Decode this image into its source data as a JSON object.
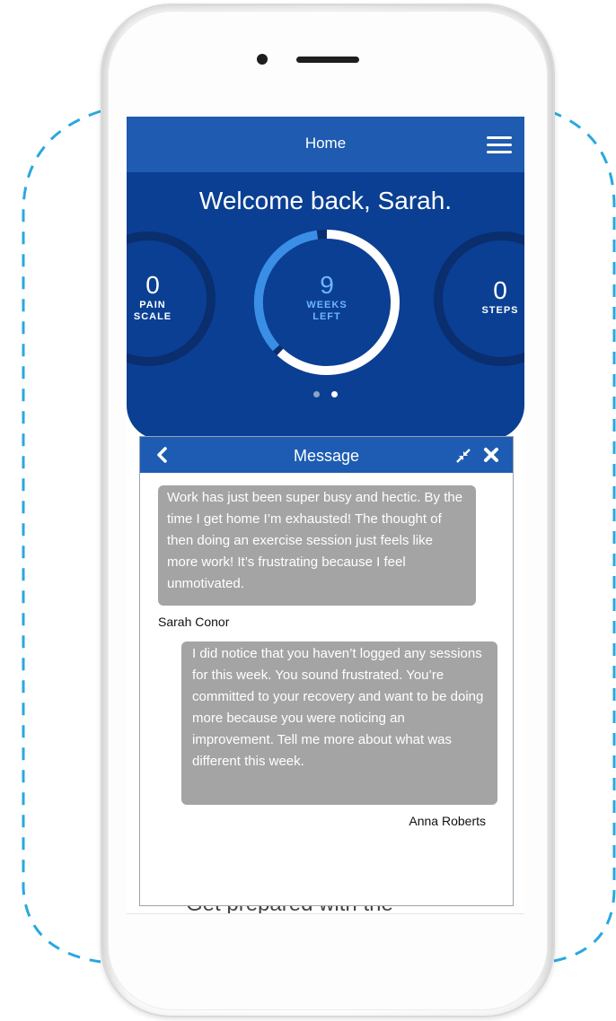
{
  "app": {
    "header_title": "Home",
    "menu_icon": "hamburger-menu-icon",
    "welcome": "Welcome back, Sarah."
  },
  "stats": {
    "pain": {
      "value": "0",
      "label_line1": "PAIN",
      "label_line2": "SCALE"
    },
    "weeks": {
      "value": "9",
      "label_line1": "WEEKS",
      "label_line2": "LEFT",
      "progress_fraction": 0.62
    },
    "steps": {
      "value": "0",
      "label_line1": "STEPS"
    }
  },
  "message_panel": {
    "title": "Message",
    "back_icon": "chevron-left-icon",
    "shrink_icon": "collapse-arrows-icon",
    "close_icon": "close-icon",
    "messages": [
      {
        "text": "Work has just been super busy and hectic. By the time I get home I’m exhausted! The thought of then doing an exercise session just feels like more work! It’s frustrating because I feel unmotivated.",
        "sender": "Sarah Conor"
      },
      {
        "text": "I did notice that you haven’t logged any sessions for this week. You sound frustrated. You’re committed to your recovery and want to be doing more because you were noticing an improvement. Tell me more about what was different this week.",
        "sender": "Anna Roberts"
      }
    ]
  },
  "peek_text": "Get prepared with the",
  "colors": {
    "topbar": "#1f5bb0",
    "hero": "#0a3f93",
    "ring_track": "#0a2e6e",
    "ring_accent": "#3a8ee6",
    "bubble": "#a4a4a4",
    "frame_dash": "#29a8e0"
  }
}
